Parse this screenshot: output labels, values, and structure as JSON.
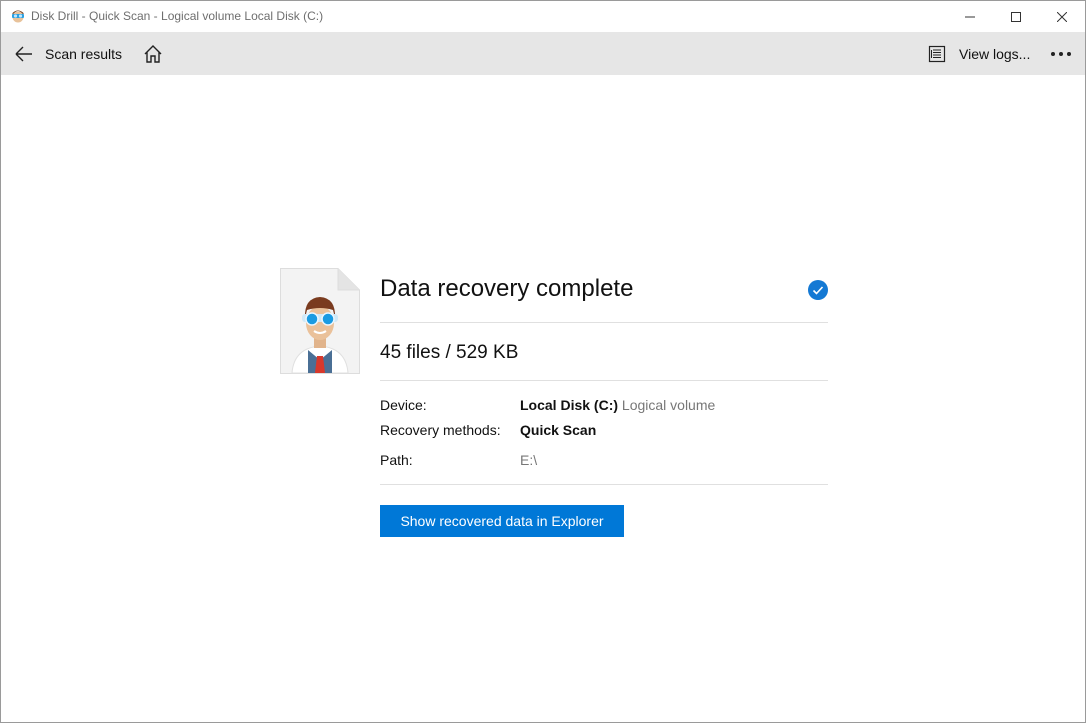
{
  "window": {
    "title": "Disk Drill - Quick Scan - Logical volume Local Disk (C:)",
    "controls": {
      "minimize": "minimize",
      "maximize": "maximize",
      "close": "close"
    }
  },
  "toolbar": {
    "back_label": "Scan results",
    "view_logs_label": "View logs...",
    "icons": [
      "arrow-left-icon",
      "home-icon",
      "logs-icon",
      "more-icon"
    ]
  },
  "result": {
    "heading": "Data recovery complete",
    "status": "complete",
    "summary": "45 files / 529 KB",
    "details": [
      {
        "label": "Device:",
        "value": "Local Disk (C:)",
        "sub": "Logical volume"
      },
      {
        "label": "Recovery methods:",
        "value": "Quick Scan"
      },
      {
        "label": "Path:",
        "value": "E:\\"
      }
    ],
    "action_label": "Show recovered data in Explorer"
  },
  "colors": {
    "accent": "#0078d7",
    "toolbar_bg": "#e6e6e6"
  }
}
